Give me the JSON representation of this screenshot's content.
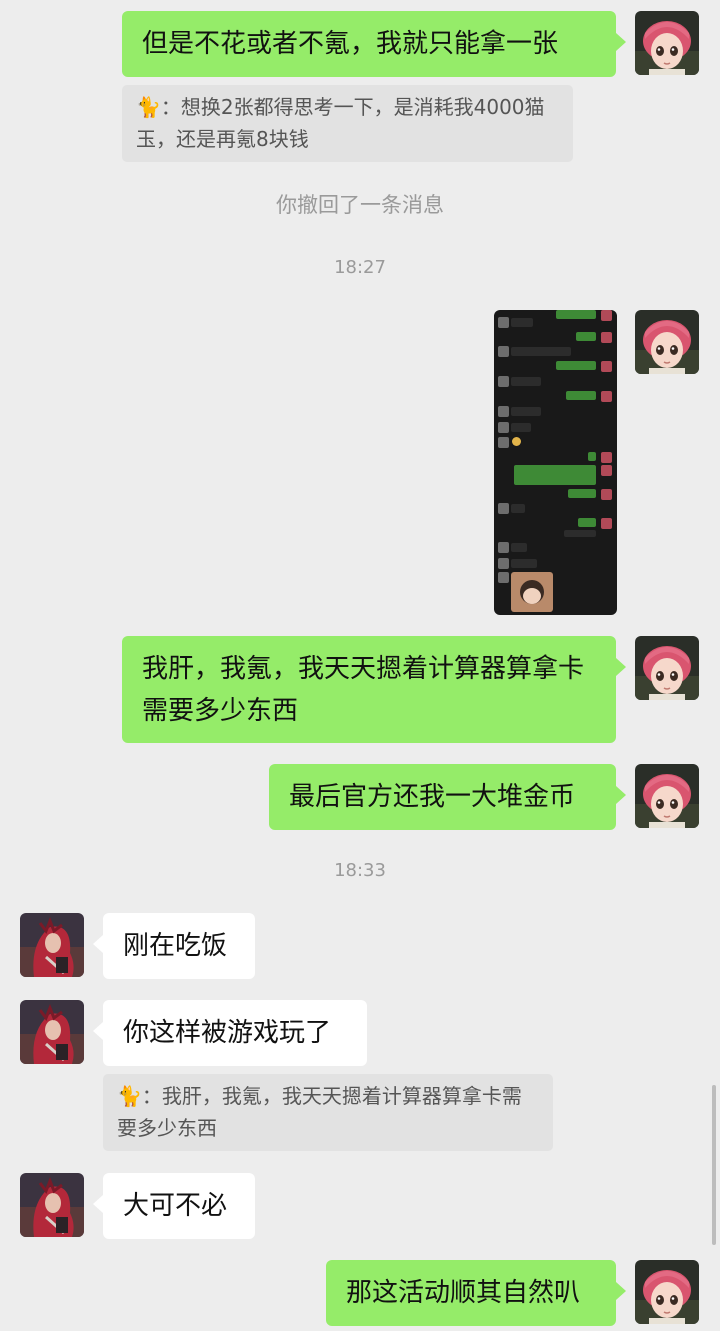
{
  "messages": {
    "m1": "但是不花或者不氪，我就只能拿一张",
    "q1": "🐈：想换2张都得思考一下，是消耗我4000猫玉，还是再氪8块钱",
    "recall": "你撤回了一条消息",
    "time1": "18:27",
    "m2": "我肝，我氪，我天天摁着计算器算拿卡需要多少东西",
    "m3": "最后官方还我一大堆金币",
    "time2": "18:33",
    "m4": "刚在吃饭",
    "m5": "你这样被游戏玩了",
    "q2": "🐈：我肝，我氪，我天天摁着计算器算拿卡需要多少东西",
    "m6": "大可不必",
    "m7": "那这活动顺其自然叭"
  },
  "icons": {
    "self_avatar": "doll-avatar",
    "friend_avatar": "red-hair-character-avatar",
    "shared_image": "chat-screenshot-thumbnail"
  },
  "colors": {
    "background": "#ededed",
    "outgoing_bubble": "#95ec69",
    "incoming_bubble": "#ffffff",
    "quote_bubble": "#e2e2e2"
  }
}
